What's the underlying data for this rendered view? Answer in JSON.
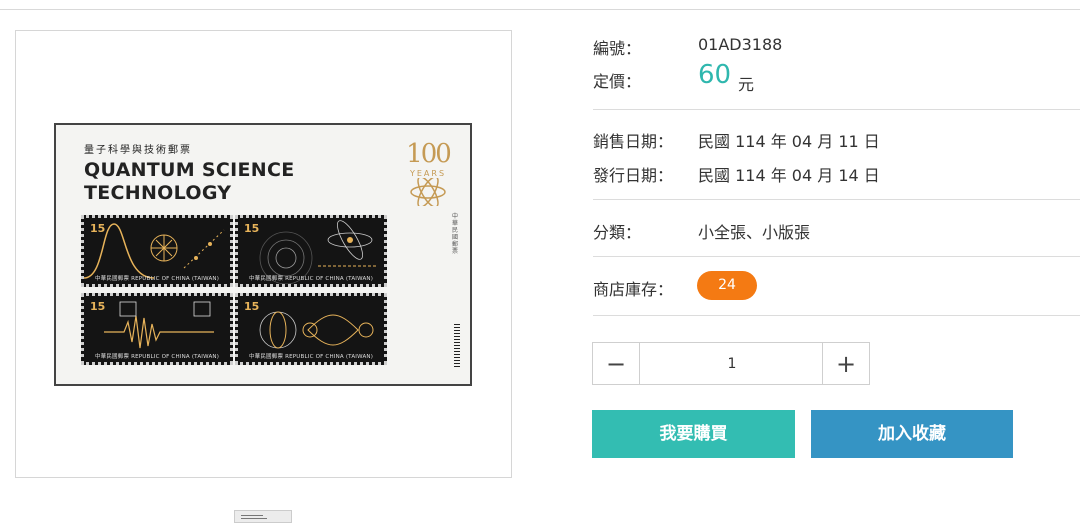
{
  "product": {
    "number_label": "編號：",
    "number": "01AD3188",
    "price_label": "定價：",
    "price": "60",
    "price_unit": "元",
    "sale_date_label": "銷售日期：",
    "sale_date": "民國 114 年 04 月 11 日",
    "issue_date_label": "發行日期：",
    "issue_date": "民國 114 年 04 月 14 日",
    "category_label": "分類：",
    "category": "小全張、小版張",
    "stock_label": "商店庫存：",
    "stock": "24"
  },
  "quantity": {
    "value": "1",
    "minus": "−",
    "plus": "+"
  },
  "actions": {
    "buy": "我要購買",
    "favorite": "加入收藏"
  },
  "stamp_sheet": {
    "title_zh": "量子科學與技術郵票",
    "title_en_line1": "QUANTUM SCIENCE",
    "title_en_line2": "TECHNOLOGY",
    "anniversary_number": "100",
    "anniversary_text": "YEARS",
    "denomination": "15",
    "stamp_footer_1": "中華民國郵票   REPUBLIC OF CHINA (TAIWAN)",
    "stamp_footer_2": "中華民國郵票   REPUBLIC OF CHINA (TAIWAN)"
  },
  "colors": {
    "accent_teal": "#2fb7ae",
    "buy": "#33bdb2",
    "favorite": "#3594c4",
    "badge": "#f47a13",
    "gold": "#e7b35a"
  }
}
